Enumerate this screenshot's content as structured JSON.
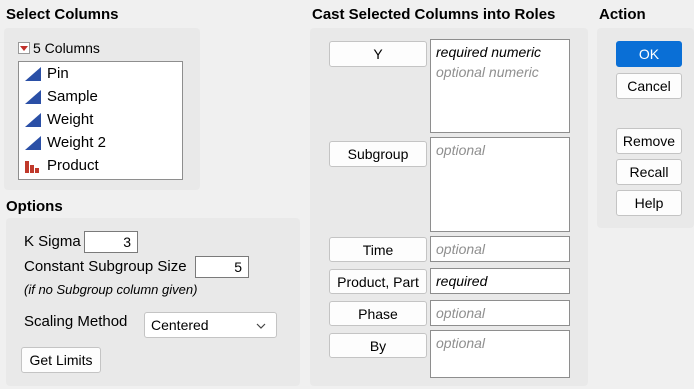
{
  "select_columns": {
    "title": "Select Columns",
    "count_label": "5 Columns",
    "columns": [
      {
        "label": "Pin",
        "icon": "continuous-icon"
      },
      {
        "label": "Sample",
        "icon": "continuous-icon"
      },
      {
        "label": "Weight",
        "icon": "continuous-icon"
      },
      {
        "label": "Weight 2",
        "icon": "continuous-icon"
      },
      {
        "label": "Product",
        "icon": "nominal-icon"
      }
    ]
  },
  "options": {
    "title": "Options",
    "k_sigma_label": "K Sigma",
    "k_sigma_value": "3",
    "constant_subgroup_label": "Constant Subgroup Size",
    "constant_subgroup_value": "5",
    "note": "(if no Subgroup column given)",
    "scaling_label": "Scaling Method",
    "scaling_value": "Centered",
    "get_limits": "Get Limits"
  },
  "roles": {
    "title": "Cast Selected Columns into Roles",
    "y_label": "Y",
    "y_hint1": "required numeric",
    "y_hint2": "optional numeric",
    "subgroup_label": "Subgroup",
    "subgroup_hint": "optional",
    "time_label": "Time",
    "time_hint": "optional",
    "product_label": "Product, Part",
    "product_hint": "required",
    "phase_label": "Phase",
    "phase_hint": "optional",
    "by_label": "By",
    "by_hint": "optional"
  },
  "action": {
    "title": "Action",
    "ok": "OK",
    "cancel": "Cancel",
    "remove": "Remove",
    "recall": "Recall",
    "help": "Help"
  },
  "colors": {
    "primary": "#0a6fd6",
    "continuous_icon": "#2a4fa6",
    "nominal_icon": "#c0392b"
  }
}
